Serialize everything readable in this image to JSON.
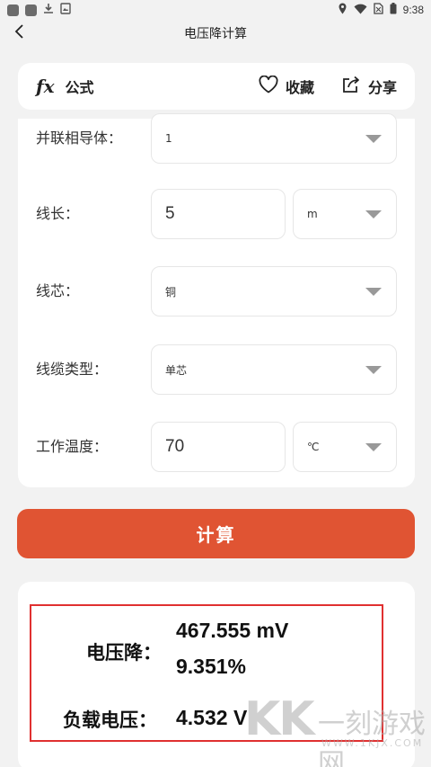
{
  "status_bar": {
    "time": "9:38",
    "icons": [
      "app-icon",
      "app-icon",
      "download-icon",
      "image-icon",
      "location-icon",
      "wifi-icon",
      "sim-icon",
      "battery-icon"
    ]
  },
  "header": {
    "title": "电压降计算",
    "back_icon": "chevron-left-icon"
  },
  "topbar": {
    "formula_icon": "fx",
    "formula_label": "公式",
    "favorite_label": "收藏",
    "share_label": "分享"
  },
  "form": {
    "parallel_conductors": {
      "label": "并联相导体：",
      "value": "1"
    },
    "length": {
      "label": "线长：",
      "value": "5",
      "unit": "m"
    },
    "core": {
      "label": "线芯：",
      "value": "铜"
    },
    "cable_type": {
      "label": "线缆类型：",
      "value": "单芯"
    },
    "temperature": {
      "label": "工作温度：",
      "value": "70",
      "unit": "℃"
    }
  },
  "calculate_label": "计算",
  "results": {
    "voltage_drop_label": "电压降：",
    "voltage_drop_value": "467.555 mV",
    "voltage_drop_percent": "9.351%",
    "load_voltage_label": "负载电压：",
    "load_voltage_value": "4.532 V"
  },
  "watermark": {
    "logo": "KK",
    "name": "一刻游戏网",
    "url": "WWW.1KJX.COM"
  },
  "colors": {
    "accent": "#e05433",
    "highlight_border": "#e03030",
    "background": "#f2f2f2"
  }
}
